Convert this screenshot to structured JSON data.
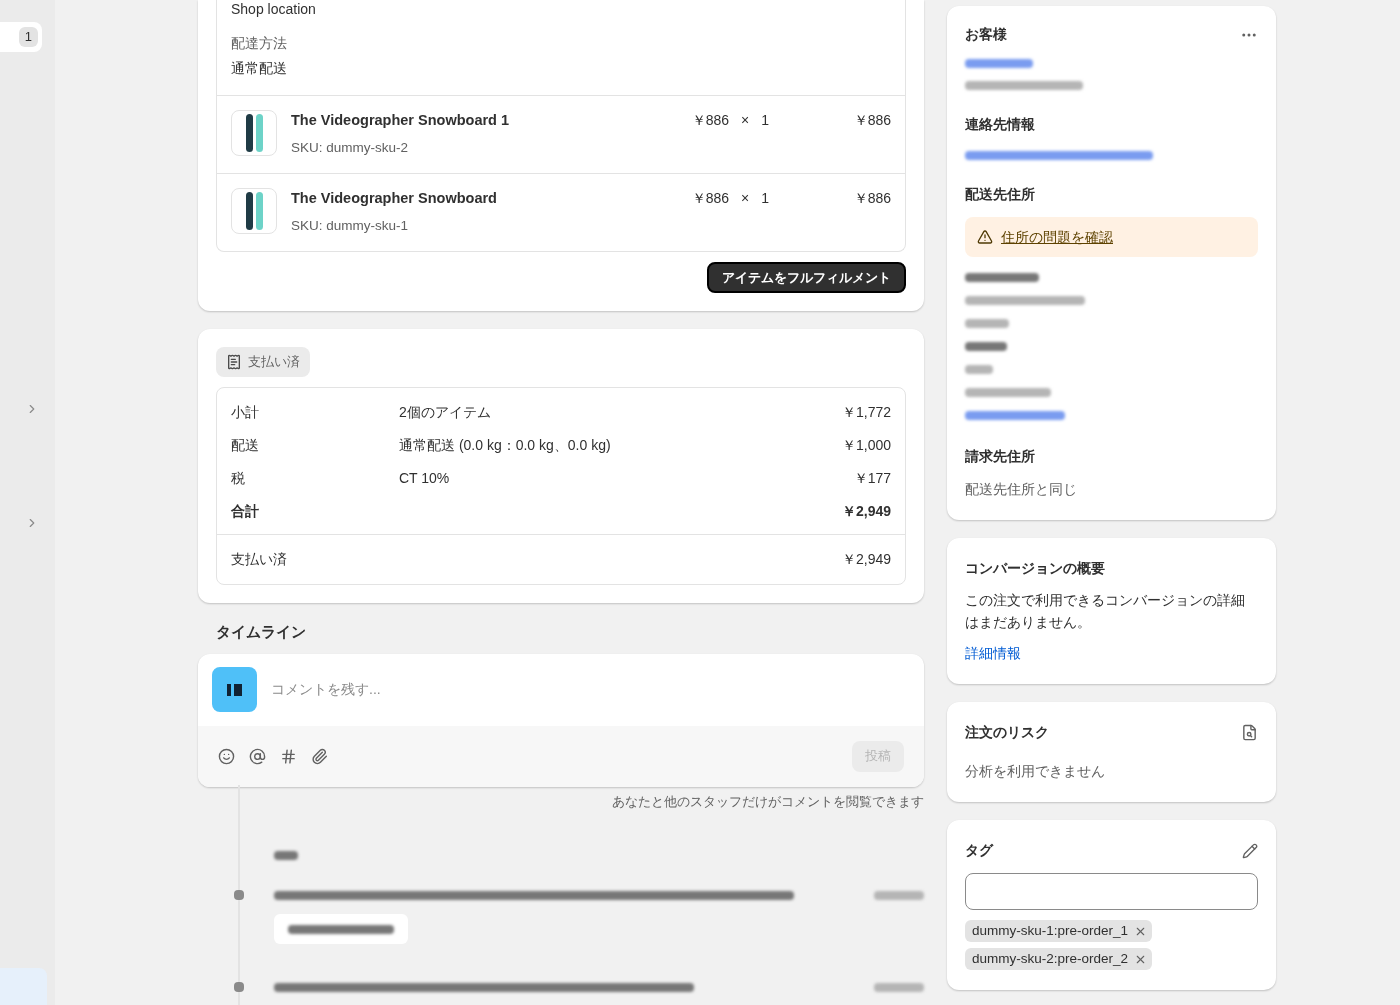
{
  "sidebar": {
    "badge": "1"
  },
  "fulfillment": {
    "location": "Shop location",
    "method_label": "配達方法",
    "method": "通常配送",
    "items": [
      {
        "title": "The Videographer Snowboard 1",
        "sku": "SKU: dummy-sku-2",
        "price": "￥886",
        "times": "×",
        "quantity": "1",
        "total": "￥886"
      },
      {
        "title": "The Videographer Snowboard",
        "sku": "SKU: dummy-sku-1",
        "price": "￥886",
        "times": "×",
        "quantity": "1",
        "total": "￥886"
      }
    ],
    "button": "アイテムをフルフィルメント"
  },
  "payment": {
    "status": "支払い済",
    "rows": [
      {
        "kind": "line",
        "label": "小計",
        "detail": "2個のアイテム",
        "amount": "￥1,772"
      },
      {
        "kind": "line",
        "label": "配送",
        "detail": "通常配送 (0.0 kg：0.0 kg、0.0 kg)",
        "amount": "￥1,000"
      },
      {
        "kind": "line",
        "label": "税",
        "detail": "CT 10%",
        "amount": "￥177"
      },
      {
        "kind": "total",
        "label": "合計",
        "amount": "￥2,949"
      }
    ],
    "paid_label": "支払い済",
    "paid_amount": "￥2,949"
  },
  "timeline": {
    "title": "タイムライン",
    "placeholder": "コメントを残す...",
    "post": "投稿",
    "post_disabled": true,
    "note": "あなたと他のスタッフだけがコメントを閲覧できます"
  },
  "customer": {
    "title": "お客様",
    "contact_title": "連絡先情報",
    "shipping_title": "配送先住所",
    "warning": "住所の問題を確認",
    "billing_title": "請求先住所",
    "billing": "配送先住所と同じ"
  },
  "conversion": {
    "title": "コンバージョンの概要",
    "text": "この注文で利用できるコンバージョンの詳細はまだありません。",
    "link": "詳細情報"
  },
  "risk": {
    "title": "注文のリスク",
    "text": "分析を利用できません"
  },
  "tags": {
    "title": "タグ",
    "items": [
      "dummy-sku-1:pre-order_1",
      "dummy-sku-2:pre-order_2"
    ]
  }
}
